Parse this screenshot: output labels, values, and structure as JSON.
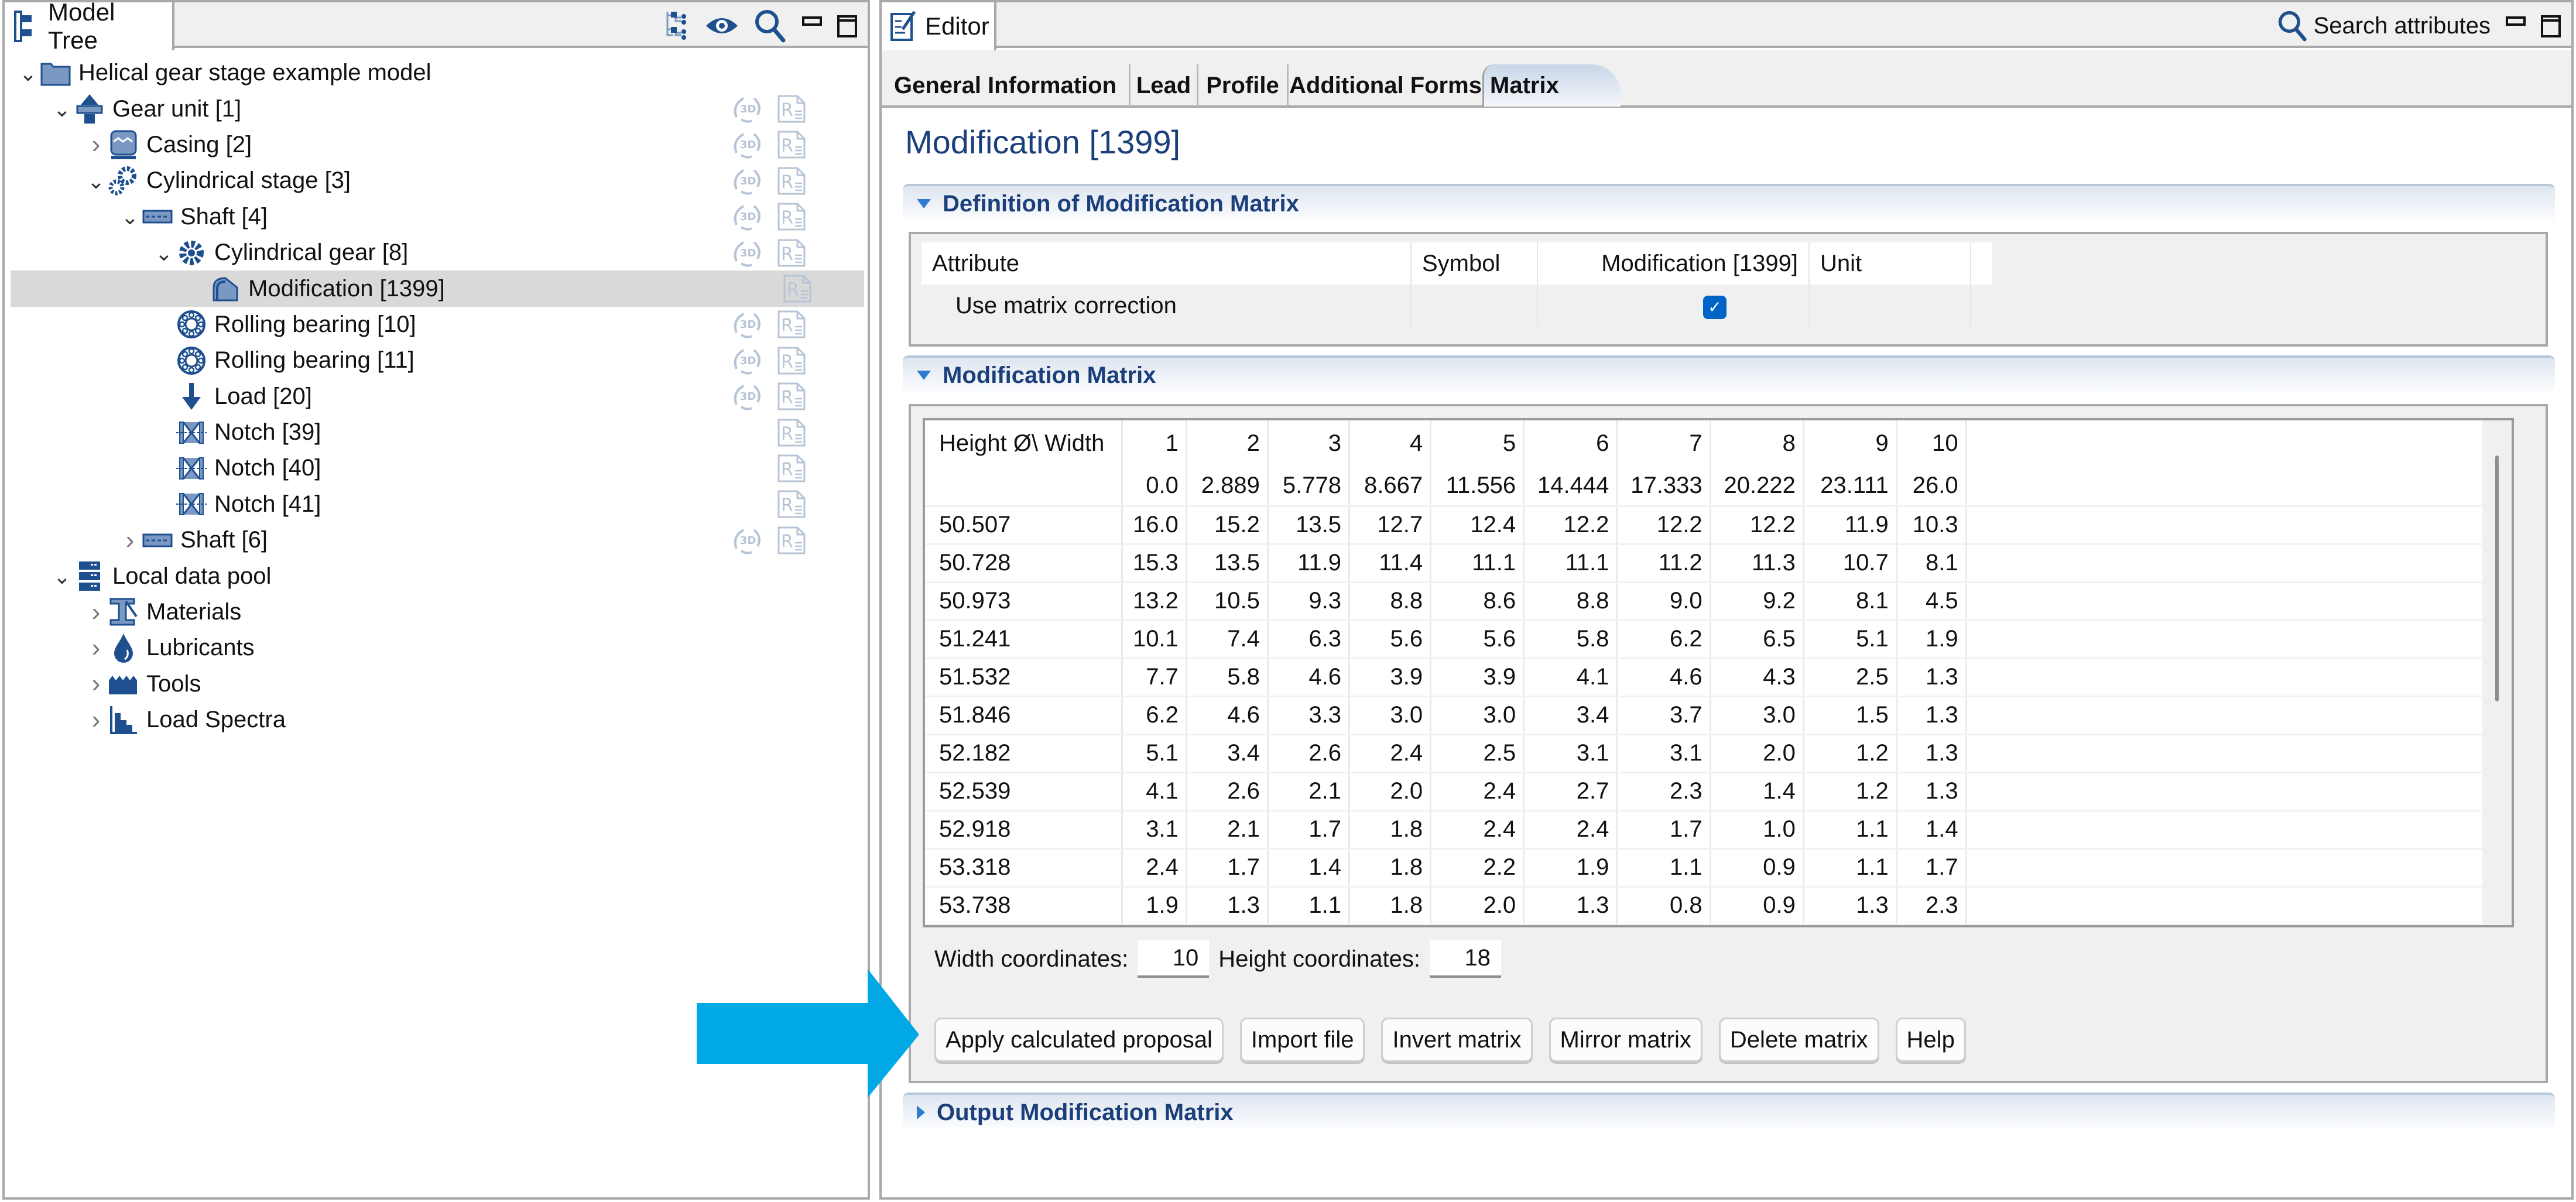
{
  "model_tree": {
    "title": "Model Tree",
    "header_icons": [
      "tree-view-icon",
      "eye-icon",
      "search-icon",
      "minimize-icon",
      "maximize-icon"
    ],
    "items": [
      {
        "label": "Helical gear stage example model",
        "level": 0,
        "expander": "expanded",
        "icon": "folder-icon",
        "actions": []
      },
      {
        "label": "Gear unit [1]",
        "level": 1,
        "expander": "expanded",
        "icon": "gear-unit-icon",
        "actions": [
          "3d-view",
          "report"
        ]
      },
      {
        "label": "Casing [2]",
        "level": 2,
        "expander": "collapsed",
        "icon": "casing-icon",
        "actions": [
          "3d-view",
          "report"
        ]
      },
      {
        "label": "Cylindrical stage [3]",
        "level": 2,
        "expander": "expanded",
        "icon": "cylindrical-stage-icon",
        "actions": [
          "3d-view",
          "report"
        ]
      },
      {
        "label": "Shaft [4]",
        "level": 3,
        "expander": "expanded",
        "icon": "shaft-icon",
        "actions": [
          "3d-view",
          "report"
        ]
      },
      {
        "label": "Cylindrical gear [8]",
        "level": 4,
        "expander": "expanded",
        "icon": "cylindrical-gear-icon",
        "actions": [
          "3d-view",
          "report"
        ]
      },
      {
        "label": "Modification [1399]",
        "level": 5,
        "expander": "none",
        "icon": "modification-icon",
        "actions": [
          "report"
        ],
        "selected": true
      },
      {
        "label": "Rolling bearing [10]",
        "level": 4,
        "expander": "none",
        "icon": "rolling-bearing-icon",
        "actions": [
          "3d-view",
          "report"
        ]
      },
      {
        "label": "Rolling bearing [11]",
        "level": 4,
        "expander": "none",
        "icon": "rolling-bearing-icon",
        "actions": [
          "3d-view",
          "report"
        ]
      },
      {
        "label": "Load [20]",
        "level": 4,
        "expander": "none",
        "icon": "load-arrow-icon",
        "actions": [
          "3d-view",
          "report"
        ]
      },
      {
        "label": "Notch [39]",
        "level": 4,
        "expander": "none",
        "icon": "notch-icon",
        "actions": [
          "report"
        ]
      },
      {
        "label": "Notch [40]",
        "level": 4,
        "expander": "none",
        "icon": "notch-icon",
        "actions": [
          "report"
        ]
      },
      {
        "label": "Notch [41]",
        "level": 4,
        "expander": "none",
        "icon": "notch-icon",
        "actions": [
          "report"
        ]
      },
      {
        "label": "Shaft [6]",
        "level": 3,
        "expander": "collapsed",
        "icon": "shaft-icon",
        "actions": [
          "3d-view",
          "report"
        ]
      },
      {
        "label": "Local data pool",
        "level": 1,
        "expander": "expanded",
        "icon": "data-pool-icon",
        "actions": []
      },
      {
        "label": "Materials",
        "level": 2,
        "expander": "collapsed",
        "icon": "materials-icon",
        "actions": []
      },
      {
        "label": "Lubricants",
        "level": 2,
        "expander": "collapsed",
        "icon": "lubricant-drop-icon",
        "actions": []
      },
      {
        "label": "Tools",
        "level": 2,
        "expander": "collapsed",
        "icon": "tools-icon",
        "actions": []
      },
      {
        "label": "Load Spectra",
        "level": 2,
        "expander": "collapsed",
        "icon": "load-spectra-icon",
        "actions": []
      }
    ]
  },
  "editor": {
    "title": "Editor",
    "search_label": "Search attributes",
    "tabs": [
      {
        "label": "General Information",
        "active": false
      },
      {
        "label": "Lead",
        "active": false
      },
      {
        "label": "Profile",
        "active": false
      },
      {
        "label": "Additional Forms",
        "active": false
      },
      {
        "label": "Matrix",
        "active": true
      }
    ],
    "page_title": "Modification [1399]",
    "definition_section": {
      "title": "Definition of Modification Matrix",
      "expanded": true,
      "columns": [
        "Attribute",
        "Symbol",
        "Modification [1399]",
        "Unit"
      ],
      "rows": [
        {
          "attribute": "Use matrix correction",
          "symbol": "",
          "value_checked": true,
          "unit": ""
        }
      ]
    },
    "matrix_section": {
      "title": "Modification Matrix",
      "expanded": true,
      "corner_label": "Height Ø\\ Width",
      "column_indices": [
        "1",
        "2",
        "3",
        "4",
        "5",
        "6",
        "7",
        "8",
        "9",
        "10"
      ],
      "width_positions": [
        "0.0",
        "2.889",
        "5.778",
        "8.667",
        "11.556",
        "14.444",
        "17.333",
        "20.222",
        "23.111",
        "26.0"
      ],
      "rows": [
        {
          "height": "50.507",
          "values": [
            "16.0",
            "15.2",
            "13.5",
            "12.7",
            "12.4",
            "12.2",
            "12.2",
            "12.2",
            "11.9",
            "10.3"
          ]
        },
        {
          "height": "50.728",
          "values": [
            "15.3",
            "13.5",
            "11.9",
            "11.4",
            "11.1",
            "11.1",
            "11.2",
            "11.3",
            "10.7",
            "8.1"
          ]
        },
        {
          "height": "50.973",
          "values": [
            "13.2",
            "10.5",
            "9.3",
            "8.8",
            "8.6",
            "8.8",
            "9.0",
            "9.2",
            "8.1",
            "4.5"
          ]
        },
        {
          "height": "51.241",
          "values": [
            "10.1",
            "7.4",
            "6.3",
            "5.6",
            "5.6",
            "5.8",
            "6.2",
            "6.5",
            "5.1",
            "1.9"
          ]
        },
        {
          "height": "51.532",
          "values": [
            "7.7",
            "5.8",
            "4.6",
            "3.9",
            "3.9",
            "4.1",
            "4.6",
            "4.3",
            "2.5",
            "1.3"
          ]
        },
        {
          "height": "51.846",
          "values": [
            "6.2",
            "4.6",
            "3.3",
            "3.0",
            "3.0",
            "3.4",
            "3.7",
            "3.0",
            "1.5",
            "1.3"
          ]
        },
        {
          "height": "52.182",
          "values": [
            "5.1",
            "3.4",
            "2.6",
            "2.4",
            "2.5",
            "3.1",
            "3.1",
            "2.0",
            "1.2",
            "1.3"
          ]
        },
        {
          "height": "52.539",
          "values": [
            "4.1",
            "2.6",
            "2.1",
            "2.0",
            "2.4",
            "2.7",
            "2.3",
            "1.4",
            "1.2",
            "1.3"
          ]
        },
        {
          "height": "52.918",
          "values": [
            "3.1",
            "2.1",
            "1.7",
            "1.8",
            "2.4",
            "2.4",
            "1.7",
            "1.0",
            "1.1",
            "1.4"
          ]
        },
        {
          "height": "53.318",
          "values": [
            "2.4",
            "1.7",
            "1.4",
            "1.8",
            "2.2",
            "1.9",
            "1.1",
            "0.9",
            "1.1",
            "1.7"
          ]
        },
        {
          "height": "53.738",
          "values": [
            "1.9",
            "1.3",
            "1.1",
            "1.8",
            "2.0",
            "1.3",
            "0.8",
            "0.9",
            "1.3",
            "2.3"
          ]
        }
      ],
      "width_coordinates_label": "Width coordinates:",
      "width_coordinates_value": "10",
      "height_coordinates_label": "Height coordinates:",
      "height_coordinates_value": "18",
      "buttons": [
        "Apply calculated proposal",
        "Import file",
        "Invert matrix",
        "Mirror matrix",
        "Delete matrix",
        "Help"
      ]
    },
    "output_section": {
      "title": "Output Modification Matrix",
      "expanded": false
    }
  },
  "annotation": {
    "arrow_color": "#00a9e6",
    "points_to": "Apply calculated proposal"
  },
  "colors": {
    "accent_blue": "#1b3f7a",
    "icon_blue": "#1e4f8f",
    "checkbox_blue": "#0063c6",
    "selection_gray": "#d9d9d9",
    "panel_gray": "#f0f0f0"
  }
}
